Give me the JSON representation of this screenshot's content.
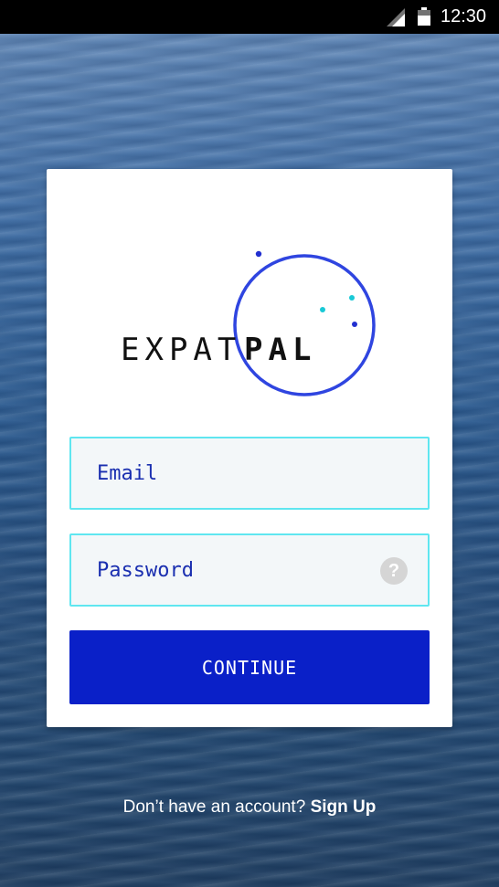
{
  "status_bar": {
    "time": "12:30",
    "icons": [
      "signal-icon",
      "battery-icon"
    ]
  },
  "logo": {
    "text_light": "EXPAT",
    "text_bold": "PAL",
    "colors": {
      "ring": "#2f45e0",
      "dot_dark": "#2230d0",
      "dot_cyan": "#19c9d6"
    }
  },
  "form": {
    "email_placeholder": "Email",
    "email_value": "",
    "password_placeholder": "Password",
    "password_value": "",
    "help_icon_glyph": "?",
    "continue_label": "CONTINUE"
  },
  "footer": {
    "prompt": "Don’t have an account? ",
    "signup_label": "Sign Up"
  },
  "theme": {
    "accent": "#0a20c8",
    "field_border": "#5fe6f0",
    "field_bg": "#f3f7f9",
    "field_text": "#1a2fb0"
  }
}
